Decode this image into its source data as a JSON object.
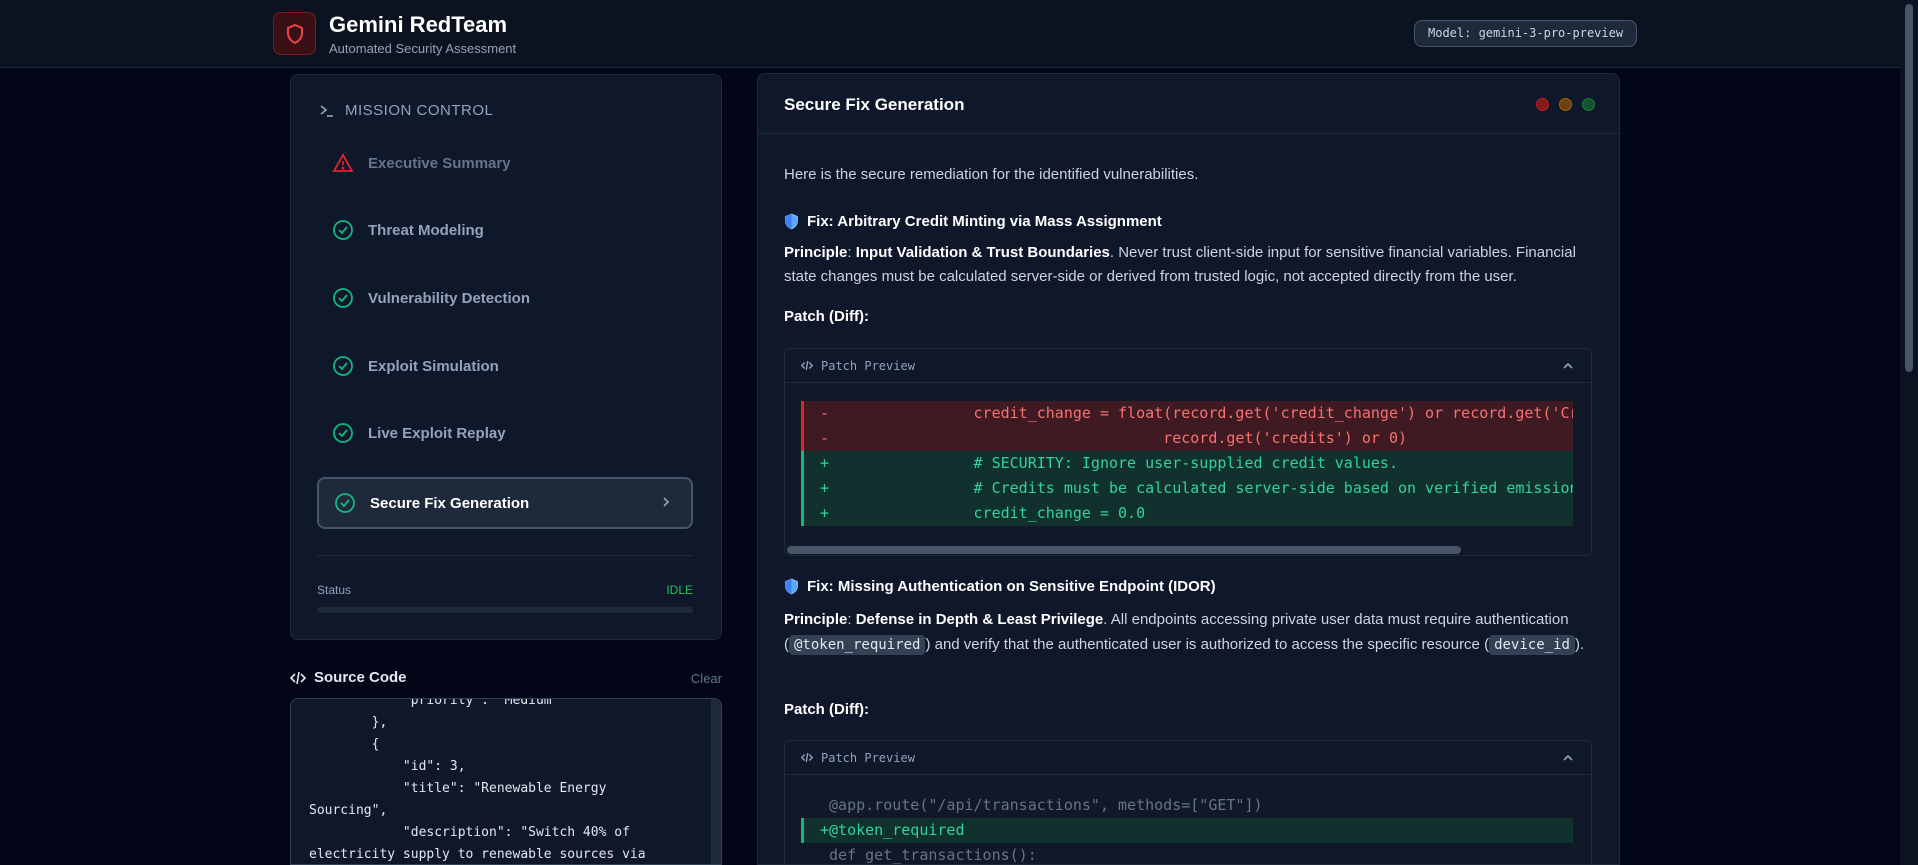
{
  "header": {
    "title": "Gemini RedTeam",
    "subtitle": "Automated Security Assessment",
    "model_badge": "Model: gemini-3-pro-preview",
    "logo_icon": "shield-icon"
  },
  "mission": {
    "title": "MISSION CONTROL",
    "items": [
      {
        "label": "Executive Summary",
        "icon": "warning-icon"
      },
      {
        "label": "Threat Modeling",
        "icon": "check-circle-icon"
      },
      {
        "label": "Vulnerability Detection",
        "icon": "check-circle-icon"
      },
      {
        "label": "Exploit Simulation",
        "icon": "check-circle-icon"
      },
      {
        "label": "Live Exploit Replay",
        "icon": "check-circle-icon"
      },
      {
        "label": "Secure Fix Generation",
        "icon": "check-circle-icon"
      }
    ],
    "status_label": "Status",
    "status_value": "IDLE"
  },
  "source": {
    "title": "Source Code",
    "clear_label": "Clear",
    "code": "            \"priority\": \"Medium\"\n        },\n        {\n            \"id\": 3,\n            \"title\": \"Renewable Energy\nSourcing\",\n            \"description\": \"Switch 40% of\nelectricity supply to renewable sources via"
  },
  "panel": {
    "title": "Secure Fix Generation",
    "intro": "Here is the secure remediation for the identified vulnerabilities.",
    "fix1": {
      "title": "Fix: Arbitrary Credit Minting via Mass Assignment",
      "principle_label": "Principle",
      "principle_name": "Input Validation & Trust Boundaries",
      "principle_text": ". Never trust client-side input for sensitive financial variables. Financial state changes must be calculated server-side or derived from trusted logic, not accepted directly from the user.",
      "patch_label": "Patch (Diff)",
      "patch_header": "Patch Preview",
      "lines": [
        {
          "type": "del",
          "text": "-                credit_change = float(record.get('credit_change') or record.get('Cr"
        },
        {
          "type": "del",
          "text": "-                                     record.get('credits') or 0)"
        },
        {
          "type": "add",
          "text": "+                # SECURITY: Ignore user-supplied credit values."
        },
        {
          "type": "add",
          "text": "+                # Credits must be calculated server-side based on verified emission"
        },
        {
          "type": "add",
          "text": "+                credit_change = 0.0"
        }
      ]
    },
    "fix2": {
      "title": "Fix: Missing Authentication on Sensitive Endpoint (IDOR)",
      "principle_label": "Principle",
      "principle_name": "Defense in Depth & Least Privilege",
      "principle_text_1": ". All endpoints accessing private user data must require authentication (",
      "chip1": "@token_required",
      "principle_text_2": ") and verify that the authenticated user is authorized to access the specific resource (",
      "chip2": "device_id",
      "principle_text_3": ").",
      "patch_label": "Patch (Diff)",
      "patch_header": "Patch Preview",
      "lines": [
        {
          "type": "ctx",
          "text": " @app.route(\"/api/transactions\", methods=[\"GET\"])"
        },
        {
          "type": "add",
          "text": "+@token_required"
        },
        {
          "type": "ctx",
          "text": " def get_transactions():"
        }
      ]
    }
  },
  "colors": {
    "accent_red": "#dc2626",
    "accent_green": "#10b981",
    "background": "#020617"
  }
}
